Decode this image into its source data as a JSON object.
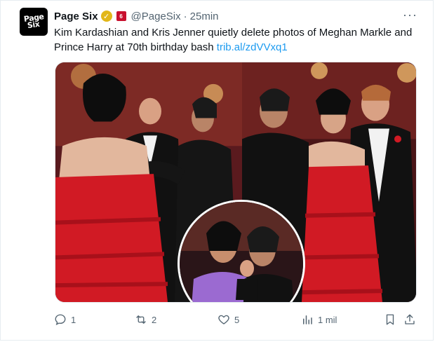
{
  "account": {
    "display_name": "Page Six",
    "handle": "@PageSix",
    "separator": "·",
    "time": "25min",
    "avatar_logo_lines": [
      "Page",
      "Six"
    ]
  },
  "tweet": {
    "text": "Kim Kardashian and Kris Jenner quietly delete photos of Meghan Markle and Prince Harry at 70th birthday bash ",
    "link": "trib.al/zdVVxq1"
  },
  "actions": {
    "replies": "1",
    "retweets": "2",
    "likes": "5",
    "views": "1 mil"
  },
  "icons": {
    "verified": "verified-badge-icon",
    "affiliate": "affiliate-badge-icon",
    "more": "more-options-icon",
    "reply": "reply-icon",
    "retweet": "retweet-icon",
    "like": "heart-icon",
    "views": "analytics-icon",
    "bookmark": "bookmark-icon",
    "share": "share-icon"
  },
  "colors": {
    "link": "#1d9bf0",
    "secondary_text": "#536471",
    "verified_gold": "#e2b719"
  }
}
